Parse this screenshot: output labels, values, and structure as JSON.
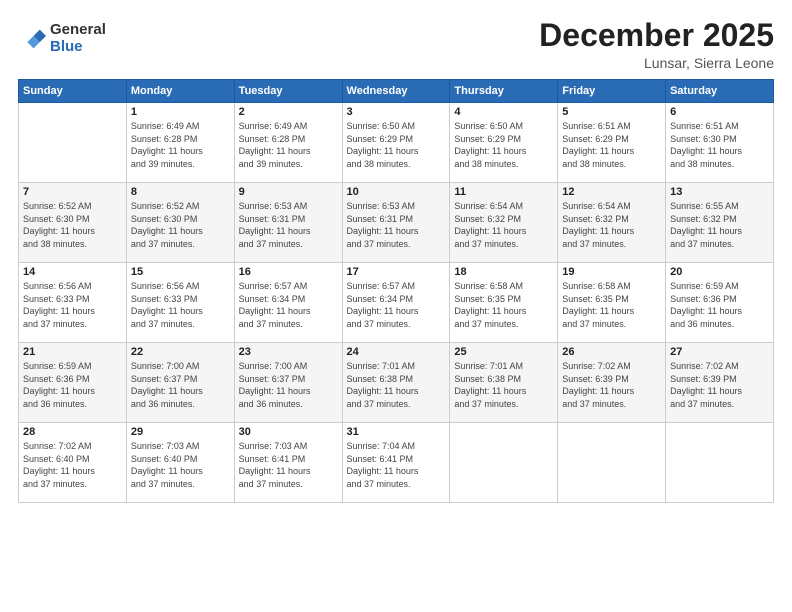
{
  "logo": {
    "general": "General",
    "blue": "Blue"
  },
  "header": {
    "month": "December 2025",
    "location": "Lunsar, Sierra Leone"
  },
  "days_of_week": [
    "Sunday",
    "Monday",
    "Tuesday",
    "Wednesday",
    "Thursday",
    "Friday",
    "Saturday"
  ],
  "weeks": [
    [
      {
        "day": "",
        "info": ""
      },
      {
        "day": "1",
        "info": "Sunrise: 6:49 AM\nSunset: 6:28 PM\nDaylight: 11 hours\nand 39 minutes."
      },
      {
        "day": "2",
        "info": "Sunrise: 6:49 AM\nSunset: 6:28 PM\nDaylight: 11 hours\nand 39 minutes."
      },
      {
        "day": "3",
        "info": "Sunrise: 6:50 AM\nSunset: 6:29 PM\nDaylight: 11 hours\nand 38 minutes."
      },
      {
        "day": "4",
        "info": "Sunrise: 6:50 AM\nSunset: 6:29 PM\nDaylight: 11 hours\nand 38 minutes."
      },
      {
        "day": "5",
        "info": "Sunrise: 6:51 AM\nSunset: 6:29 PM\nDaylight: 11 hours\nand 38 minutes."
      },
      {
        "day": "6",
        "info": "Sunrise: 6:51 AM\nSunset: 6:30 PM\nDaylight: 11 hours\nand 38 minutes."
      }
    ],
    [
      {
        "day": "7",
        "info": "Sunrise: 6:52 AM\nSunset: 6:30 PM\nDaylight: 11 hours\nand 38 minutes."
      },
      {
        "day": "8",
        "info": "Sunrise: 6:52 AM\nSunset: 6:30 PM\nDaylight: 11 hours\nand 37 minutes."
      },
      {
        "day": "9",
        "info": "Sunrise: 6:53 AM\nSunset: 6:31 PM\nDaylight: 11 hours\nand 37 minutes."
      },
      {
        "day": "10",
        "info": "Sunrise: 6:53 AM\nSunset: 6:31 PM\nDaylight: 11 hours\nand 37 minutes."
      },
      {
        "day": "11",
        "info": "Sunrise: 6:54 AM\nSunset: 6:32 PM\nDaylight: 11 hours\nand 37 minutes."
      },
      {
        "day": "12",
        "info": "Sunrise: 6:54 AM\nSunset: 6:32 PM\nDaylight: 11 hours\nand 37 minutes."
      },
      {
        "day": "13",
        "info": "Sunrise: 6:55 AM\nSunset: 6:32 PM\nDaylight: 11 hours\nand 37 minutes."
      }
    ],
    [
      {
        "day": "14",
        "info": "Sunrise: 6:56 AM\nSunset: 6:33 PM\nDaylight: 11 hours\nand 37 minutes."
      },
      {
        "day": "15",
        "info": "Sunrise: 6:56 AM\nSunset: 6:33 PM\nDaylight: 11 hours\nand 37 minutes."
      },
      {
        "day": "16",
        "info": "Sunrise: 6:57 AM\nSunset: 6:34 PM\nDaylight: 11 hours\nand 37 minutes."
      },
      {
        "day": "17",
        "info": "Sunrise: 6:57 AM\nSunset: 6:34 PM\nDaylight: 11 hours\nand 37 minutes."
      },
      {
        "day": "18",
        "info": "Sunrise: 6:58 AM\nSunset: 6:35 PM\nDaylight: 11 hours\nand 37 minutes."
      },
      {
        "day": "19",
        "info": "Sunrise: 6:58 AM\nSunset: 6:35 PM\nDaylight: 11 hours\nand 37 minutes."
      },
      {
        "day": "20",
        "info": "Sunrise: 6:59 AM\nSunset: 6:36 PM\nDaylight: 11 hours\nand 36 minutes."
      }
    ],
    [
      {
        "day": "21",
        "info": "Sunrise: 6:59 AM\nSunset: 6:36 PM\nDaylight: 11 hours\nand 36 minutes."
      },
      {
        "day": "22",
        "info": "Sunrise: 7:00 AM\nSunset: 6:37 PM\nDaylight: 11 hours\nand 36 minutes."
      },
      {
        "day": "23",
        "info": "Sunrise: 7:00 AM\nSunset: 6:37 PM\nDaylight: 11 hours\nand 36 minutes."
      },
      {
        "day": "24",
        "info": "Sunrise: 7:01 AM\nSunset: 6:38 PM\nDaylight: 11 hours\nand 37 minutes."
      },
      {
        "day": "25",
        "info": "Sunrise: 7:01 AM\nSunset: 6:38 PM\nDaylight: 11 hours\nand 37 minutes."
      },
      {
        "day": "26",
        "info": "Sunrise: 7:02 AM\nSunset: 6:39 PM\nDaylight: 11 hours\nand 37 minutes."
      },
      {
        "day": "27",
        "info": "Sunrise: 7:02 AM\nSunset: 6:39 PM\nDaylight: 11 hours\nand 37 minutes."
      }
    ],
    [
      {
        "day": "28",
        "info": "Sunrise: 7:02 AM\nSunset: 6:40 PM\nDaylight: 11 hours\nand 37 minutes."
      },
      {
        "day": "29",
        "info": "Sunrise: 7:03 AM\nSunset: 6:40 PM\nDaylight: 11 hours\nand 37 minutes."
      },
      {
        "day": "30",
        "info": "Sunrise: 7:03 AM\nSunset: 6:41 PM\nDaylight: 11 hours\nand 37 minutes."
      },
      {
        "day": "31",
        "info": "Sunrise: 7:04 AM\nSunset: 6:41 PM\nDaylight: 11 hours\nand 37 minutes."
      },
      {
        "day": "",
        "info": ""
      },
      {
        "day": "",
        "info": ""
      },
      {
        "day": "",
        "info": ""
      }
    ]
  ]
}
